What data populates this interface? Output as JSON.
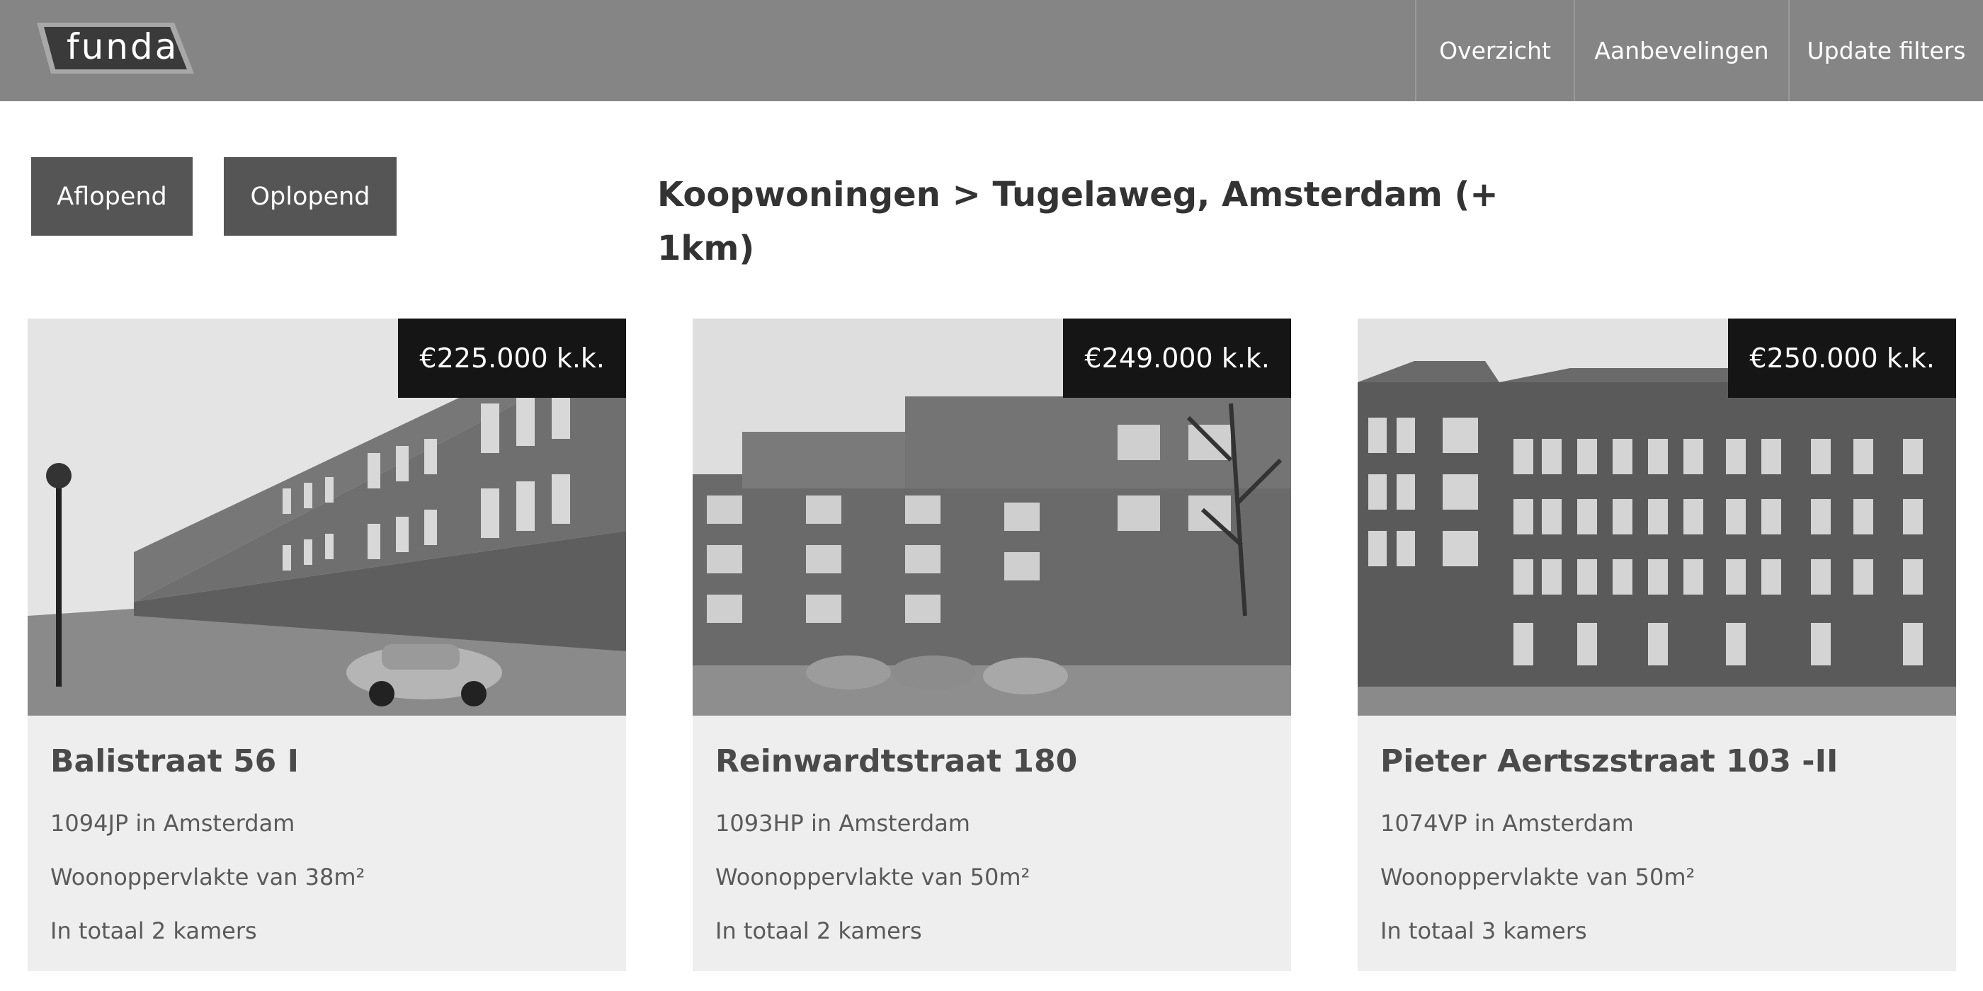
{
  "header": {
    "logo_text": "funda",
    "nav": [
      {
        "label": "Overzicht"
      },
      {
        "label": "Aanbevelingen"
      },
      {
        "label": "Update filters"
      }
    ]
  },
  "toolbar": {
    "sort_desc_label": "Aflopend",
    "sort_asc_label": "Oplopend",
    "title": "Koopwoningen > Tugelaweg, Amsterdam (+ 1km)"
  },
  "listings": [
    {
      "price": "€225.000 k.k.",
      "address": "Balistraat 56 I",
      "postal": "1094JP in Amsterdam",
      "area": "Woonoppervlakte van 38m²",
      "rooms": "In totaal 2 kamers"
    },
    {
      "price": "€249.000 k.k.",
      "address": "Reinwardtstraat 180",
      "postal": "1093HP in Amsterdam",
      "area": "Woonoppervlakte van 50m²",
      "rooms": "In totaal 2 kamers"
    },
    {
      "price": "€250.000 k.k.",
      "address": "Pieter Aertszstraat 103 -II",
      "postal": "1074VP in Amsterdam",
      "area": "Woonoppervlakte van 50m²",
      "rooms": "In totaal 3 kamers"
    }
  ],
  "colors": {
    "header_bg": "#858585",
    "button_bg": "#555555",
    "price_bg": "#151515",
    "card_bg": "#eeeeee"
  }
}
